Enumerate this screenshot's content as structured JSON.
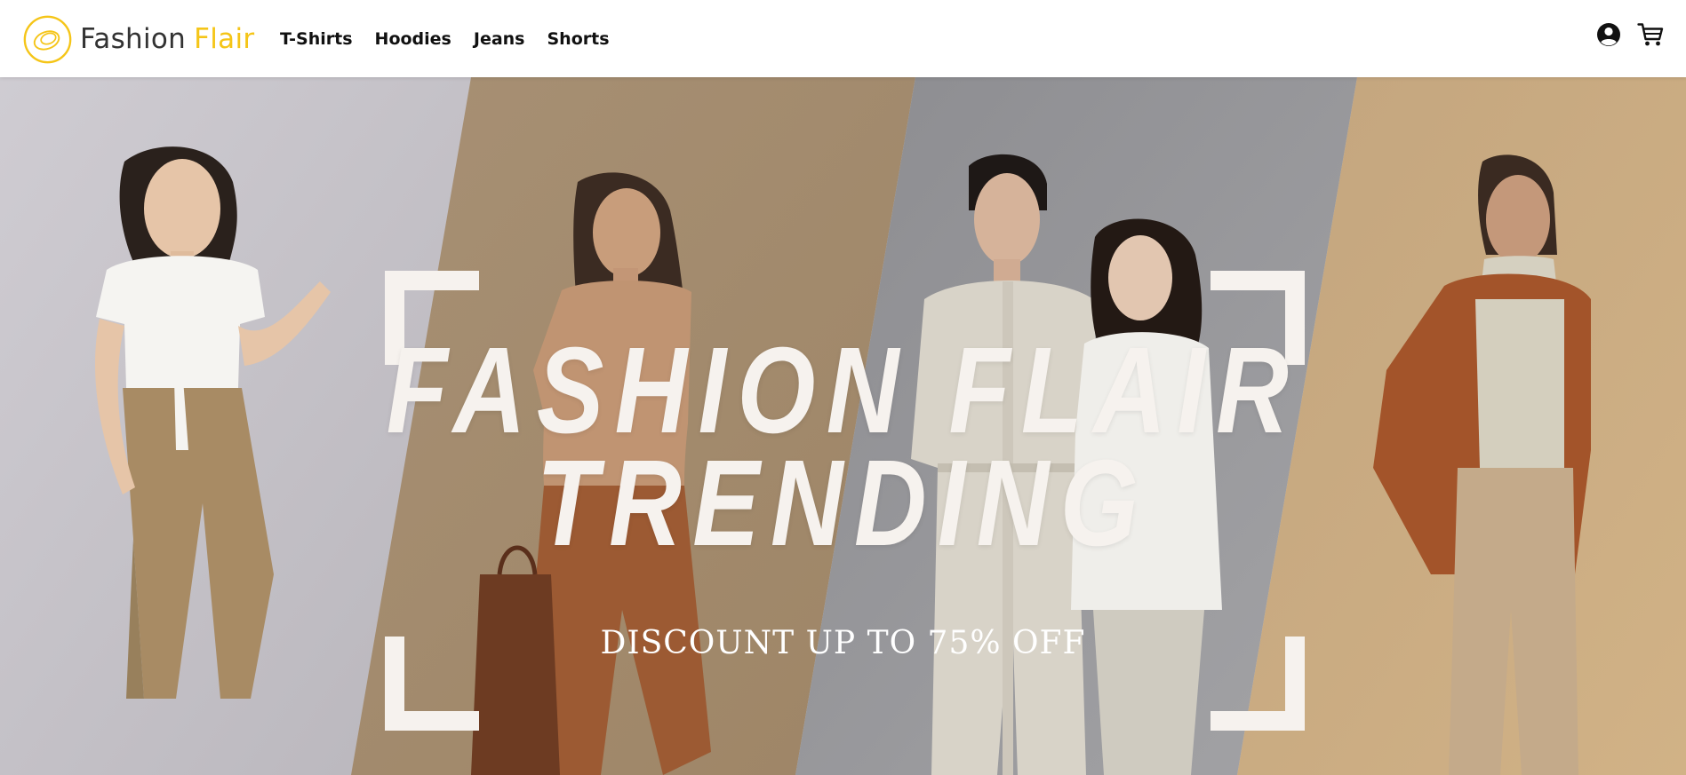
{
  "brand": {
    "name_primary": "Fashion",
    "name_accent": "Flair",
    "primary_color": "#333333",
    "accent_color": "#f5c518"
  },
  "nav": {
    "items": [
      {
        "label": "T-Shirts"
      },
      {
        "label": "Hoodies"
      },
      {
        "label": "Jeans"
      },
      {
        "label": "Shorts"
      }
    ]
  },
  "header_icons": {
    "account": "user-circle-icon",
    "cart": "shopping-cart-icon"
  },
  "hero": {
    "title_line1": "FASHION FLAIR",
    "title_line2": "TRENDING",
    "subtitle": "DISCOUNT UP TO 75% OFF",
    "text_color": "#f6f2ee",
    "panel_colors": [
      "#c8c5ca",
      "#a48c6e",
      "#8b8b8e",
      "#cbaa80"
    ]
  }
}
